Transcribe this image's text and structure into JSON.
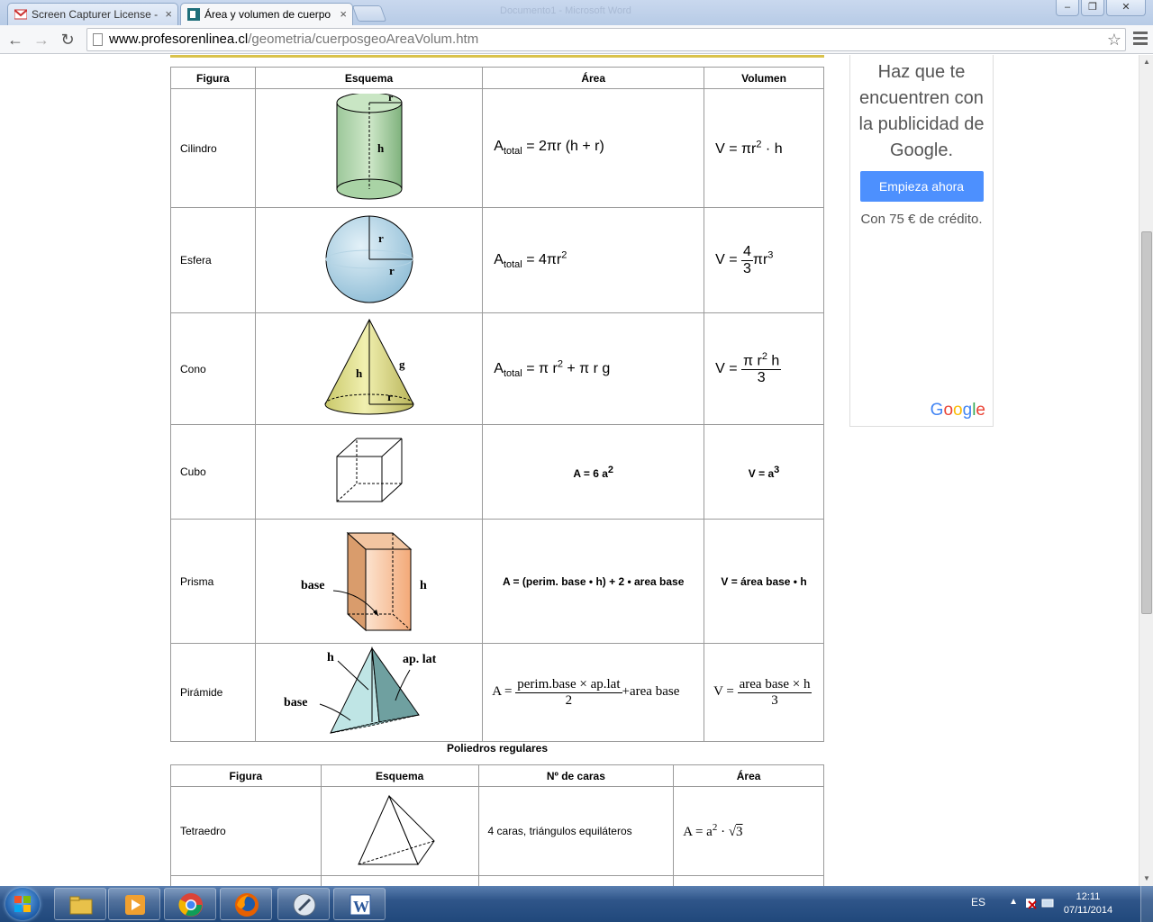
{
  "browser": {
    "tabs": [
      {
        "title": "Screen Capturer License -",
        "active": false
      },
      {
        "title": "Área y volumen de cuerpo",
        "active": true
      }
    ],
    "background_title": "Documento1 - Microsoft Word",
    "url_host": "www.profesorenlinea.cl",
    "url_path": "/geometria/cuerposgeoAreaVolum.htm"
  },
  "table1": {
    "headers": [
      "Figura",
      "Esquema",
      "Área",
      "Volumen"
    ],
    "rows": [
      {
        "name": "Cilindro"
      },
      {
        "name": "Esfera"
      },
      {
        "name": "Cono"
      },
      {
        "name": "Cubo",
        "area": "A = 6 a",
        "area_exp": "2",
        "volume": "V = a",
        "volume_exp": "3"
      },
      {
        "name": "Prisma",
        "area": "A = (perim. base • h) + 2 • area base",
        "volume": "V = área base  • h"
      },
      {
        "name": "Pirámide"
      }
    ],
    "diagram_labels": {
      "cylinder": {
        "r": "r",
        "h": "h"
      },
      "sphere": {
        "r1": "r",
        "r2": "r"
      },
      "cone": {
        "h": "h",
        "g": "g",
        "r": "r"
      },
      "prism": {
        "base": "base",
        "h": "h"
      },
      "pyramid": {
        "h": "h",
        "ap": "ap. lat",
        "base": "base"
      }
    },
    "formulas": {
      "cyl_area": {
        "lhs": "A",
        "sub": "total",
        "rhs": "= 2πr (h + r)"
      },
      "cyl_vol": {
        "lhs": "V = πr",
        "exp": "2",
        "rhs": " · h"
      },
      "sph_area": {
        "lhs": "A",
        "sub": "total",
        "rhs": "= 4πr",
        "exp": "2"
      },
      "sph_vol": {
        "lhs": "V =",
        "num": "4",
        "den": "3",
        "rhs": "πr",
        "exp": "3"
      },
      "cone_area": {
        "lhs": "A",
        "sub": "total",
        "rhs1": "= π r",
        "exp": "2",
        "rhs2": " + π r g"
      },
      "cone_vol": {
        "lhs": "V =",
        "num_a": "π r",
        "num_exp": "2",
        "num_b": " h",
        "den": "3"
      },
      "pyr_area": {
        "lhs": "A =",
        "num": "perim.base × ap.lat",
        "den": "2",
        "rhs": "+area base"
      },
      "pyr_vol": {
        "lhs": "V =",
        "num": "area base × h",
        "den": "3"
      }
    }
  },
  "table2": {
    "caption": "Poliedros regulares",
    "headers": [
      "Figura",
      "Esquema",
      "Nº de caras",
      "Área"
    ],
    "rows": [
      {
        "name": "Tetraedro",
        "faces": "4 caras, triángulos equiláteros",
        "area_lhs": "A = a",
        "area_exp": "2",
        "area_rhs": " · ",
        "area_root": "3"
      }
    ]
  },
  "ad": {
    "headline": "Haz que te encuentren con la publicidad de Google.",
    "cta": "Empieza ahora",
    "credit": "Con 75 € de crédito.",
    "logo": "Google"
  },
  "taskbar": {
    "lang": "ES",
    "time": "12:11",
    "date": "07/11/2014"
  },
  "colors": {
    "accent_blue": "#4d90fe",
    "gold_bar": "#d9c24a"
  }
}
